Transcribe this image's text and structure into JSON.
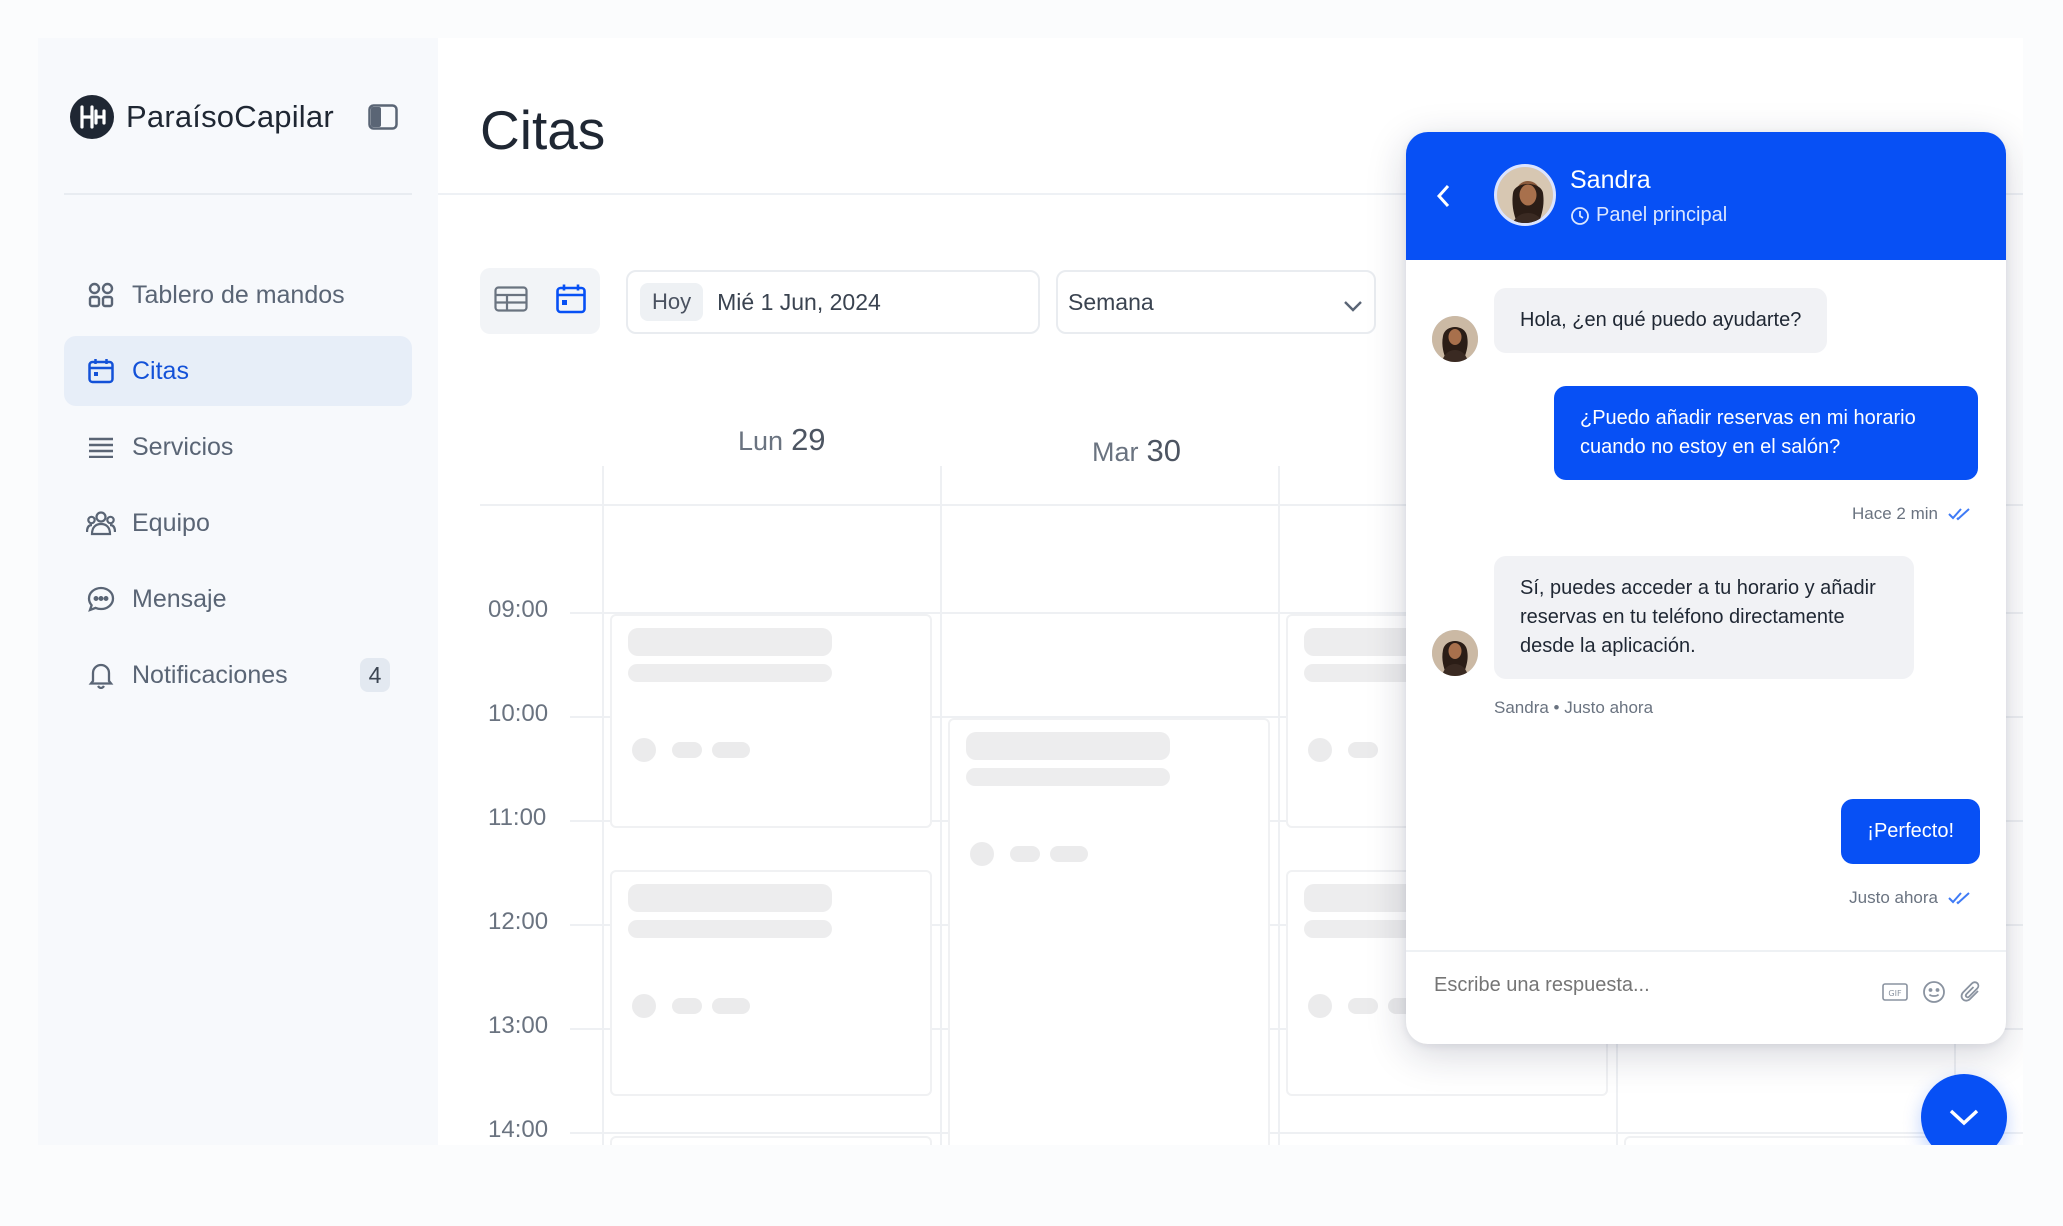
{
  "brand": {
    "name": "ParaísoCapilar"
  },
  "sidebar": {
    "items": [
      {
        "label": "Tablero de mandos",
        "icon": "grid-icon"
      },
      {
        "label": "Citas",
        "icon": "calendar-icon",
        "active": true
      },
      {
        "label": "Servicios",
        "icon": "list-icon"
      },
      {
        "label": "Equipo",
        "icon": "team-icon"
      },
      {
        "label": "Mensaje",
        "icon": "chat-bubble-icon"
      },
      {
        "label": "Notificaciones",
        "icon": "bell-icon",
        "badge": "4"
      }
    ]
  },
  "main": {
    "title": "Citas",
    "toolbar": {
      "today_label": "Hoy",
      "date": "Mié 1 Jun, 2024",
      "range_value": "Semana"
    },
    "days": [
      {
        "name": "Lun",
        "num": "29"
      },
      {
        "name": "Mar",
        "num": "30"
      }
    ],
    "times": [
      "09:00",
      "10:00",
      "11:00",
      "12:00",
      "13:00",
      "14:00"
    ]
  },
  "chat": {
    "contact_name": "Sandra",
    "contact_sub": "Panel principal",
    "messages": [
      {
        "from": "them",
        "text": "Hola, ¿en qué puedo ayudarte?"
      },
      {
        "from": "me",
        "text": "¿Puedo añadir reservas en mi horario cuando no estoy en el salón?",
        "meta": "Hace 2 min"
      },
      {
        "from": "them",
        "text": "Sí, puedes acceder a tu horario y añadir reservas en tu teléfono directamente desde la aplicación.",
        "meta": "Sandra • Justo ahora"
      },
      {
        "from": "me",
        "text": "¡Perfecto!",
        "meta": "Justo ahora"
      }
    ],
    "input_placeholder": "Escribe una respuesta..."
  },
  "colors": {
    "accent": "#0750f5",
    "active_nav_bg": "#e7eef8",
    "active_nav_text": "#1351d8",
    "sidebar_bg": "#f7f9fc"
  }
}
